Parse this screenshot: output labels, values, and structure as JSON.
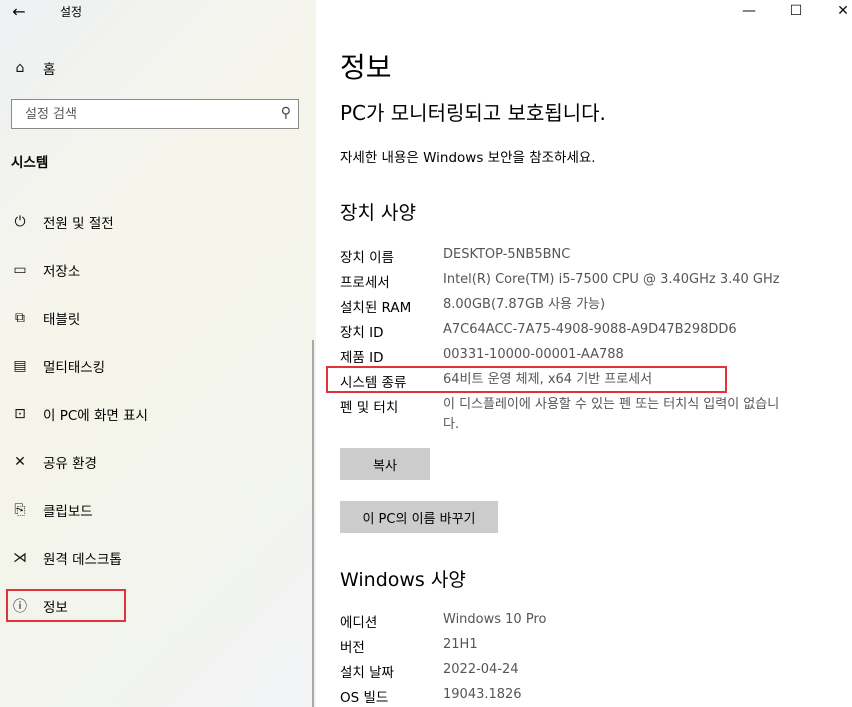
{
  "window": {
    "app_title": "설정",
    "back": "←",
    "minimize": "—",
    "maximize": "☐",
    "close": "✕"
  },
  "sidebar": {
    "home": {
      "icon": "⌂",
      "label": "홈"
    },
    "search": {
      "placeholder": "설정 검색",
      "icon": "⚲"
    },
    "section": "시스템",
    "items": [
      {
        "icon": "⏻",
        "label": "전원 및 절전"
      },
      {
        "icon": "▭",
        "label": "저장소"
      },
      {
        "icon": "⧉",
        "label": "태블릿"
      },
      {
        "icon": "▤",
        "label": "멀티태스킹"
      },
      {
        "icon": "⊡",
        "label": "이 PC에 화면 표시"
      },
      {
        "icon": "✕",
        "label": "공유 환경"
      },
      {
        "icon": "⎘",
        "label": "클립보드"
      },
      {
        "icon": "⋊",
        "label": "원격 데스크톱"
      },
      {
        "icon": "ⓘ",
        "label": "정보"
      }
    ]
  },
  "main": {
    "title": "정보",
    "status_title": "PC가 모니터링되고 보호됩니다.",
    "status_desc": "자세한 내용은 Windows 보안을 참조하세요.",
    "device_heading": "장치 사양",
    "device_specs": [
      {
        "label": "장치 이름",
        "value": "DESKTOP-5NB5BNC"
      },
      {
        "label": "프로세서",
        "value": "Intel(R) Core(TM) i5-7500 CPU @ 3.40GHz   3.40 GHz"
      },
      {
        "label": "설치된 RAM",
        "value": "8.00GB(7.87GB 사용 가능)"
      },
      {
        "label": "장치 ID",
        "value": "A7C64ACC-7A75-4908-9088-A9D47B298DD6"
      },
      {
        "label": "제품 ID",
        "value": "00331-10000-00001-AA788"
      },
      {
        "label": "시스템 종류",
        "value": "64비트 운영 체제, x64 기반 프로세서"
      },
      {
        "label": "펜 및 터치",
        "value": "이 디스플레이에 사용할 수 있는 펜 또는 터치식 입력이 없습니다."
      }
    ],
    "copy_button": "복사",
    "rename_button": "이 PC의 이름 바꾸기",
    "windows_heading": "Windows 사양",
    "windows_specs": [
      {
        "label": "에디션",
        "value": "Windows 10 Pro"
      },
      {
        "label": "버전",
        "value": "21H1"
      },
      {
        "label": "설치 날짜",
        "value": "2022-04-24"
      },
      {
        "label": "OS 빌드",
        "value": "19043.1826"
      }
    ]
  },
  "colors": {
    "highlight": "#e0333a",
    "button_bg": "#cccccc",
    "value_text": "#555555"
  }
}
